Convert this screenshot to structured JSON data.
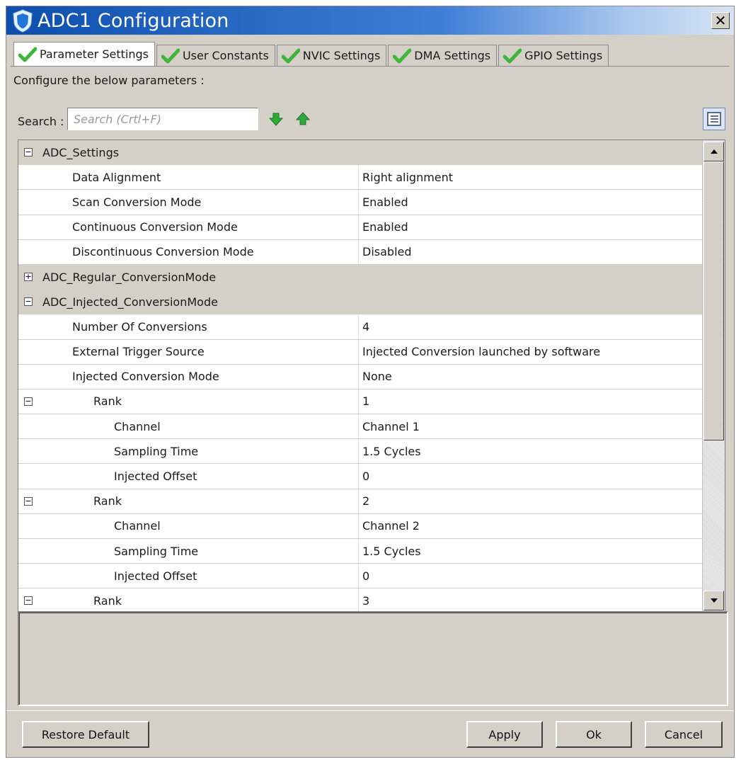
{
  "window": {
    "title": "ADC1 Configuration",
    "close_glyph": "✕"
  },
  "tabs": [
    {
      "label": "Parameter Settings",
      "active": true
    },
    {
      "label": "User Constants",
      "active": false
    },
    {
      "label": "NVIC Settings",
      "active": false
    },
    {
      "label": "DMA Settings",
      "active": false
    },
    {
      "label": "GPIO Settings",
      "active": false
    }
  ],
  "content": {
    "configure_label": "Configure the below parameters :",
    "search_label": "Search :",
    "search_placeholder": "Search (Crtl+F)"
  },
  "grid": {
    "rows": [
      {
        "type": "group",
        "expander": "−",
        "label": "ADC_Settings"
      },
      {
        "type": "param",
        "level": 1,
        "name": "Data Alignment",
        "value": "Right alignment"
      },
      {
        "type": "param",
        "level": 1,
        "name": "Scan Conversion Mode",
        "value": "Enabled"
      },
      {
        "type": "param",
        "level": 1,
        "name": "Continuous Conversion Mode",
        "value": "Enabled"
      },
      {
        "type": "param",
        "level": 1,
        "name": "Discontinuous Conversion Mode",
        "value": "Disabled"
      },
      {
        "type": "group",
        "expander": "+",
        "label": "ADC_Regular_ConversionMode"
      },
      {
        "type": "group",
        "expander": "−",
        "label": "ADC_Injected_ConversionMode"
      },
      {
        "type": "param",
        "level": 1,
        "name": "Number Of Conversions",
        "value": "4"
      },
      {
        "type": "param",
        "level": 1,
        "name": "External Trigger Source",
        "value": "Injected Conversion launched by software"
      },
      {
        "type": "param",
        "level": 1,
        "name": "Injected Conversion Mode",
        "value": "None"
      },
      {
        "type": "rank",
        "level": 2,
        "expander": "−",
        "name": "Rank",
        "value": "1"
      },
      {
        "type": "param",
        "level": 3,
        "name": "Channel",
        "value": "Channel 1"
      },
      {
        "type": "param",
        "level": 3,
        "name": "Sampling Time",
        "value": "1.5 Cycles"
      },
      {
        "type": "param",
        "level": 3,
        "name": "Injected Offset",
        "value": "0"
      },
      {
        "type": "rank",
        "level": 2,
        "expander": "−",
        "name": "Rank",
        "value": "2"
      },
      {
        "type": "param",
        "level": 3,
        "name": "Channel",
        "value": "Channel 2"
      },
      {
        "type": "param",
        "level": 3,
        "name": "Sampling Time",
        "value": "1.5 Cycles"
      },
      {
        "type": "param",
        "level": 3,
        "name": "Injected Offset",
        "value": "0"
      },
      {
        "type": "rank",
        "level": 2,
        "expander": "−",
        "name": "Rank",
        "value": "3"
      }
    ]
  },
  "buttons": {
    "restore_default": "Restore Default",
    "apply": "Apply",
    "ok": "Ok",
    "cancel": "Cancel"
  },
  "icons": {
    "title": "shield-icon",
    "tab_check": "checkmark-icon",
    "search_next": "arrow-down-icon",
    "search_prev": "arrow-up-icon",
    "view_toggle": "list-view-icon"
  },
  "colors": {
    "title_bar": "#0d4fae",
    "dialog_bg": "#d4d0c8",
    "check_green": "#3fb53a",
    "arrow_green": "#2fa83a"
  }
}
